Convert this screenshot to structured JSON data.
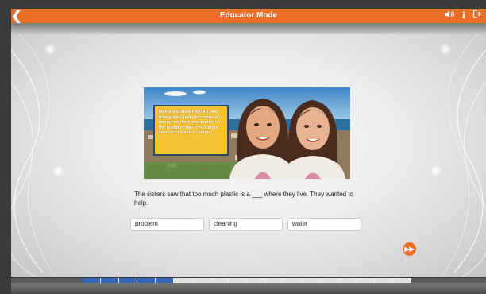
{
  "header": {
    "title": "Educator Mode",
    "back_icon": "chevron-left-icon",
    "icons": [
      "speaker-icon",
      "info-icon",
      "exit-icon"
    ],
    "accent_color": "#ec6e24"
  },
  "story": {
    "caption": "Isabel and Melati Wijsen saw how plastic pollution made an impact on their community on the island of Bali. The sisters wanted to make a change."
  },
  "question": {
    "text": "The sisters saw that too much plastic is a ___ where they live. They wanted to help."
  },
  "answers": [
    "problem",
    "cleaning",
    "water"
  ],
  "progress": {
    "total_segments": 18,
    "completed_segments": 5
  }
}
